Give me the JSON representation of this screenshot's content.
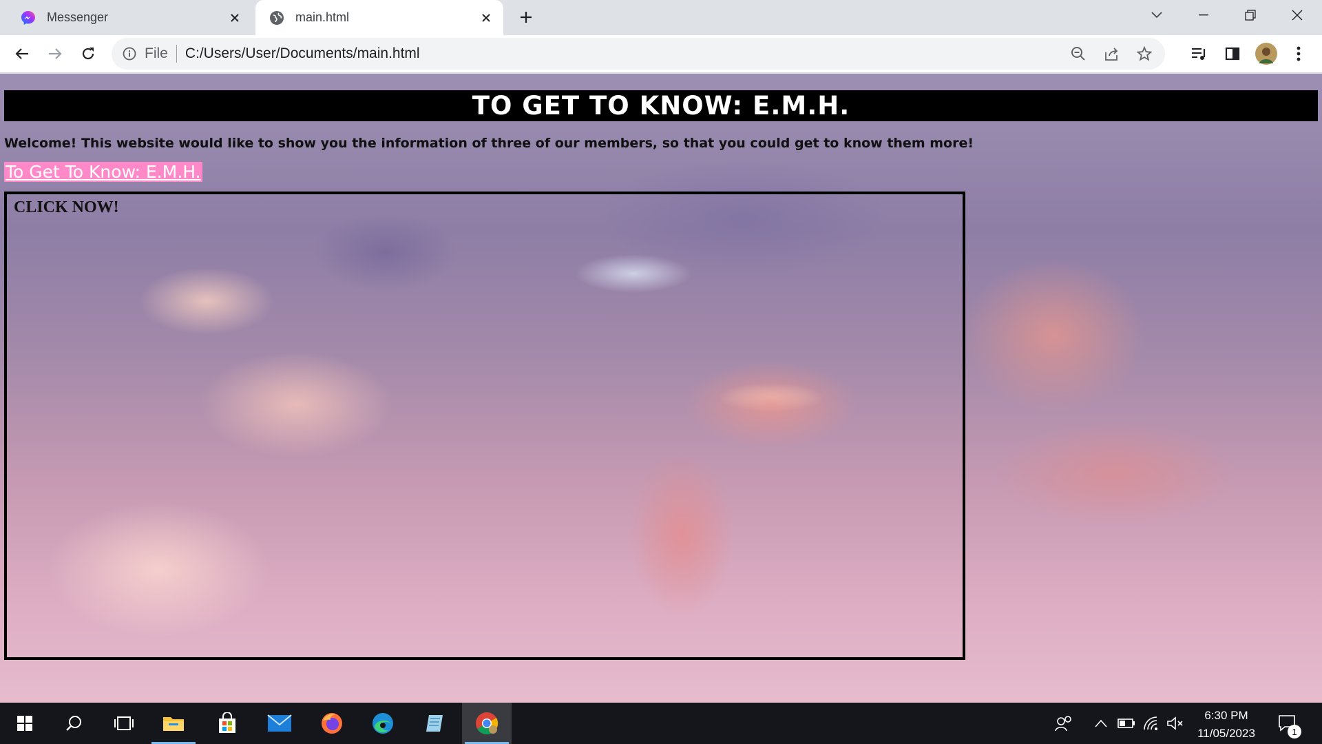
{
  "browser": {
    "tabs": [
      {
        "title": "Messenger",
        "favicon": "messenger-icon",
        "active": false
      },
      {
        "title": "main.html",
        "favicon": "globe-icon",
        "active": true
      }
    ],
    "omnibox": {
      "scheme_label": "File",
      "url": "C:/Users/User/Documents/main.html"
    }
  },
  "page": {
    "heading": "TO GET TO KNOW: E.M.H.",
    "welcome": "Welcome! This website would like to show you the information of three of our members, so that you could get to know them more!",
    "link_text": "To Get To Know: E.M.H.",
    "click_label": "CLICK NOW!"
  },
  "taskbar": {
    "time": "6:30 PM",
    "date": "11/05/2023",
    "notification_count": "1",
    "apps": [
      "start-icon",
      "search-icon",
      "task-view-icon",
      "file-explorer-icon",
      "microsoft-store-icon",
      "mail-icon",
      "firefox-icon",
      "edge-icon",
      "notepad-icon",
      "chrome-icon"
    ]
  },
  "colors": {
    "link_highlight": "#ff89c8",
    "heading_bg": "#000000",
    "taskbar_bg": "#15161b"
  }
}
